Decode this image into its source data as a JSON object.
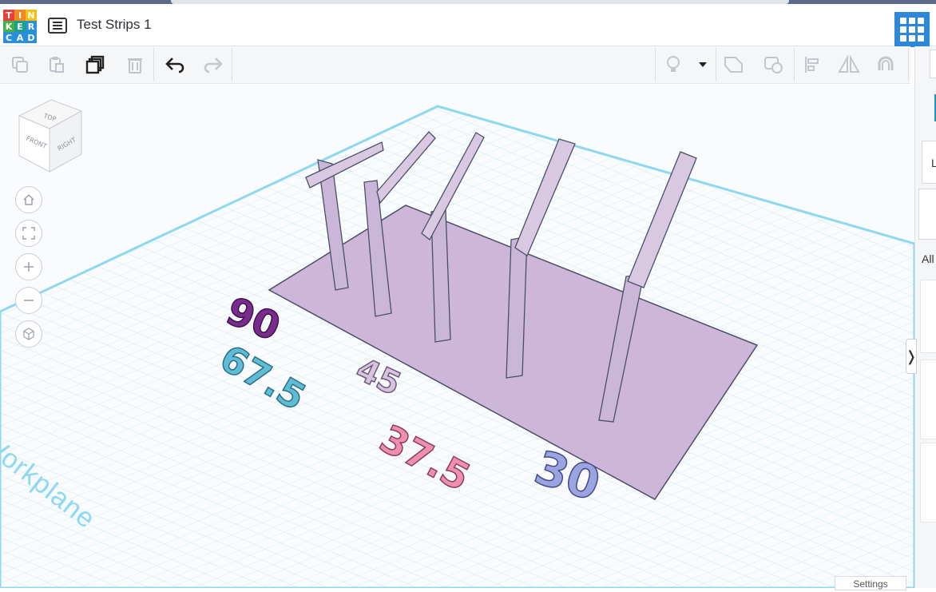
{
  "app": {
    "logo_letters": [
      "T",
      "I",
      "N",
      "K",
      "E",
      "R",
      "C",
      "A",
      "D"
    ],
    "logo_colors": [
      "#e8403a",
      "#f08a24",
      "#f5c012",
      "#46b14a",
      "#1e9f8a",
      "#2a8fd9",
      "#2a8fd9",
      "#2a8fd9",
      "#2a8fd9"
    ],
    "title": "Test Strips 1"
  },
  "toolbar": {
    "items": [
      {
        "name": "copy-button",
        "icon": "copy-icon",
        "enabled": false
      },
      {
        "name": "paste-button",
        "icon": "paste-icon",
        "enabled": false
      },
      {
        "name": "duplicate-button",
        "icon": "duplicate-icon",
        "enabled": true
      },
      {
        "name": "delete-button",
        "icon": "trash-icon",
        "enabled": false
      },
      {
        "name": "undo-button",
        "icon": "undo-icon",
        "enabled": true
      },
      {
        "name": "redo-button",
        "icon": "redo-icon",
        "enabled": false
      },
      {
        "name": "light-button",
        "icon": "bulb-icon",
        "enabled": false
      },
      {
        "name": "light-dropdown",
        "icon": "caret-down-icon",
        "enabled": true
      },
      {
        "name": "group-button",
        "icon": "shape-icon",
        "enabled": false
      },
      {
        "name": "ungroup-button",
        "icon": "ungroup-icon",
        "enabled": false
      },
      {
        "name": "align-button",
        "icon": "align-icon",
        "enabled": false
      },
      {
        "name": "mirror-button",
        "icon": "mirror-icon",
        "enabled": false
      },
      {
        "name": "cruise-button",
        "icon": "magnet-icon",
        "enabled": false
      }
    ]
  },
  "navcube": {
    "top": "TOP",
    "front": "FRONT",
    "right": "RIGHT"
  },
  "view_controls": [
    "home-icon",
    "fit-icon",
    "zoom-in-icon",
    "zoom-out-icon",
    "perspective-icon"
  ],
  "workplane_label": "Workplane",
  "right_panel": {
    "label_l": "L",
    "label_all": "All"
  },
  "settings_label": "Settings",
  "scene_numbers": [
    {
      "text": "90",
      "color": "#7a2c8e"
    },
    {
      "text": "67.5",
      "color": "#5fbcd6"
    },
    {
      "text": "45",
      "color": "#cdb8d8"
    },
    {
      "text": "37.5",
      "color": "#ee8fb0"
    },
    {
      "text": "30",
      "color": "#9aa4df"
    }
  ],
  "colors": {
    "accent": "#2e88d9",
    "plate": "#cdb6da",
    "grid": "#bfe6f5"
  }
}
